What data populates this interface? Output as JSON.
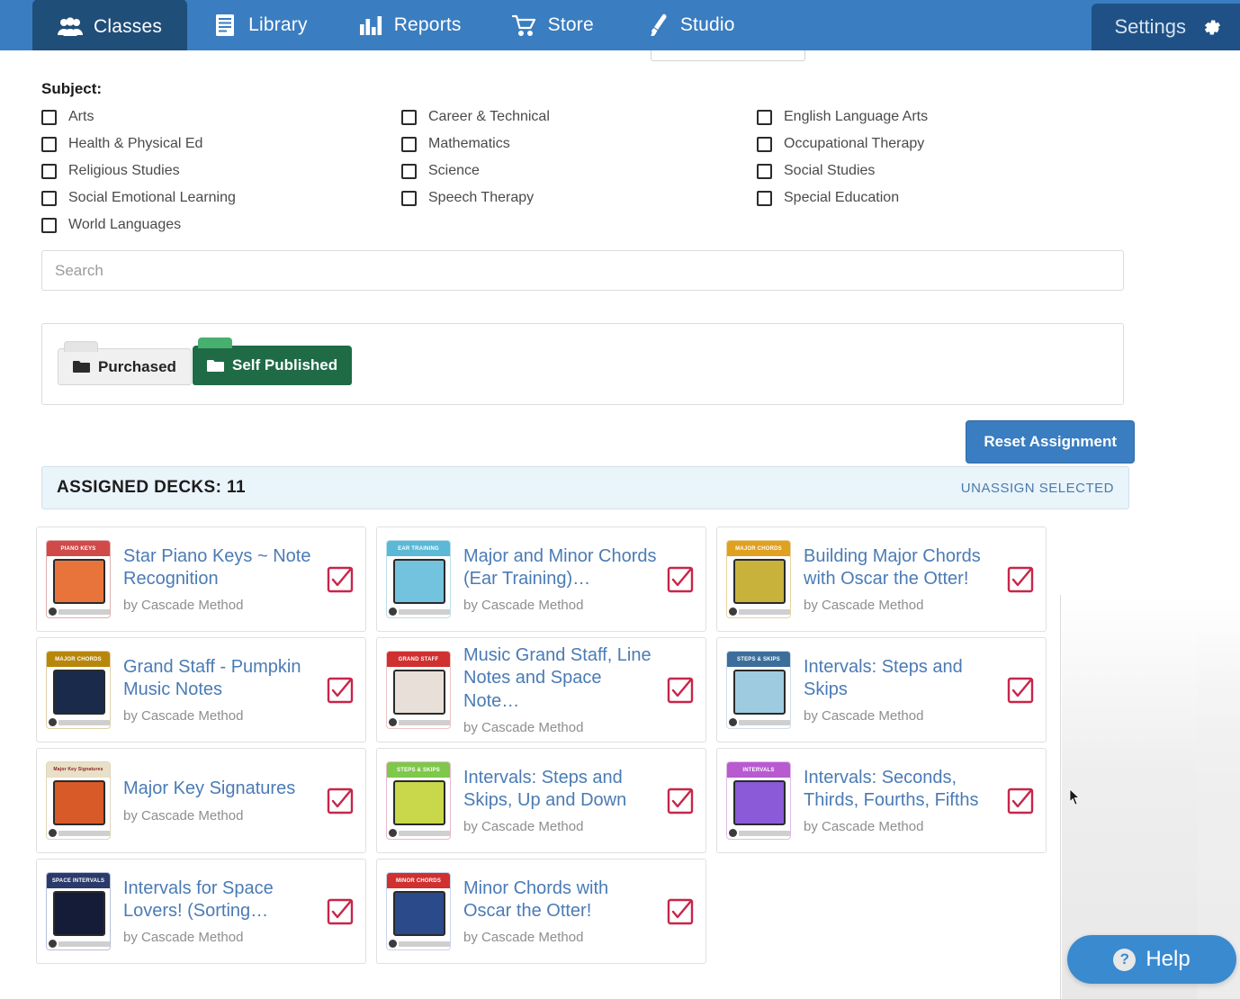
{
  "nav": {
    "items": [
      {
        "label": "Classes",
        "icon": "people-icon",
        "active": true
      },
      {
        "label": "Library",
        "icon": "book-icon",
        "active": false
      },
      {
        "label": "Reports",
        "icon": "bar-chart-icon",
        "active": false
      },
      {
        "label": "Store",
        "icon": "shopping-cart-icon",
        "active": false
      },
      {
        "label": "Studio",
        "icon": "paintbrush-icon",
        "active": false
      }
    ],
    "settings_label": "Settings",
    "settings_icon": "gear-icon",
    "bar_color": "#3a7dc0",
    "active_color": "#1f4e79"
  },
  "subject": {
    "title": "Subject:",
    "options": [
      "Arts",
      "Career & Technical",
      "English Language Arts",
      "Health & Physical Ed",
      "Mathematics",
      "Occupational Therapy",
      "Religious Studies",
      "Science",
      "Social Studies",
      "Social Emotional Learning",
      "Speech Therapy",
      "Special Education",
      "World Languages"
    ]
  },
  "search": {
    "placeholder": "Search",
    "value": ""
  },
  "folders": {
    "tabs": [
      {
        "label": "Purchased",
        "icon": "folder-icon",
        "active": false
      },
      {
        "label": "Self Published",
        "icon": "folder-icon",
        "active": true
      }
    ],
    "active_color": "#1f6b46"
  },
  "actions": {
    "reset_label": "Reset Assignment"
  },
  "assigned": {
    "label": "ASSIGNED DECKS: 11",
    "count": 11,
    "unassign_label": "UNASSIGN SELECTED"
  },
  "decks": [
    {
      "title": "Star Piano Keys ~ Note Recognition",
      "author": "by Cascade Method",
      "checked": true,
      "thumb": {
        "header": "PIANO KEYS",
        "header_bg": "#d04a4a",
        "screen_bg": "#e8743c",
        "border": "#e0b0b0"
      }
    },
    {
      "title": "Major and Minor Chords (Ear Training)…",
      "author": "by Cascade Method",
      "checked": true,
      "thumb": {
        "header": "EAR TRAINING",
        "header_bg": "#5bb8d6",
        "screen_bg": "#74c3de",
        "border": "#bcdfe9"
      }
    },
    {
      "title": "Building Major Chords with Oscar the Otter!",
      "author": "by Cascade Method",
      "checked": true,
      "thumb": {
        "header": "MAJOR CHORDS",
        "header_bg": "#e0a020",
        "screen_bg": "#c8b23c",
        "border": "#e8d3a0"
      }
    },
    {
      "title": "Grand Staff - Pumpkin Music Notes",
      "author": "by Cascade Method",
      "checked": true,
      "thumb": {
        "header": "MAJOR CHORDS",
        "header_bg": "#b8860b",
        "screen_bg": "#1a2a4a",
        "border": "#ddd0a8"
      }
    },
    {
      "title": "Music Grand Staff, Line Notes and Space Note…",
      "author": "by Cascade Method",
      "checked": true,
      "thumb": {
        "header": "GRAND STAFF",
        "header_bg": "#d03030",
        "screen_bg": "#e8e0d8",
        "border": "#ecc4c4"
      }
    },
    {
      "title": "Intervals: Steps and Skips",
      "author": "by Cascade Method",
      "checked": true,
      "thumb": {
        "header": "STEPS & SKIPS",
        "header_bg": "#3c6e9c",
        "screen_bg": "#9ecbe0",
        "border": "#cfdde8"
      }
    },
    {
      "title": "Major Key Signatures",
      "author": "by Cascade Method",
      "checked": true,
      "thumb": {
        "header": "Major Key Signatures",
        "header_bg": "#e8e0c8",
        "screen_bg": "#d85a28",
        "border": "#e0d6bc"
      }
    },
    {
      "title": "Intervals: Steps and Skips, Up and Down",
      "author": "by Cascade Method",
      "checked": true,
      "thumb": {
        "header": "STEPS & SKIPS",
        "header_bg": "#7ec84a",
        "screen_bg": "#c8d84a",
        "border": "#e8b8d0"
      }
    },
    {
      "title": "Intervals: Seconds, Thirds, Fourths, Fifths",
      "author": "by Cascade Method",
      "checked": true,
      "thumb": {
        "header": "INTERVALS",
        "header_bg": "#b85ad0",
        "screen_bg": "#8a5ad8",
        "border": "#ddbce8"
      }
    },
    {
      "title": "Intervals for Space Lovers! (Sorting…",
      "author": "by Cascade Method",
      "checked": true,
      "thumb": {
        "header": "SPACE INTERVALS",
        "header_bg": "#2a3a6a",
        "screen_bg": "#141c38",
        "border": "#b8c0d8"
      }
    },
    {
      "title": "Minor Chords with Oscar the Otter!",
      "author": "by Cascade Method",
      "checked": true,
      "thumb": {
        "header": "MINOR CHORDS",
        "header_bg": "#d03030",
        "screen_bg": "#2a4a8a",
        "border": "#c8d4e8"
      }
    }
  ],
  "help": {
    "label": "Help",
    "icon": "question-mark-icon"
  },
  "colors": {
    "accent_blue": "#3a7dc0",
    "link_blue": "#4a7bb5",
    "check_red": "#c8254a",
    "panel_blue": "#eaf4fb"
  }
}
